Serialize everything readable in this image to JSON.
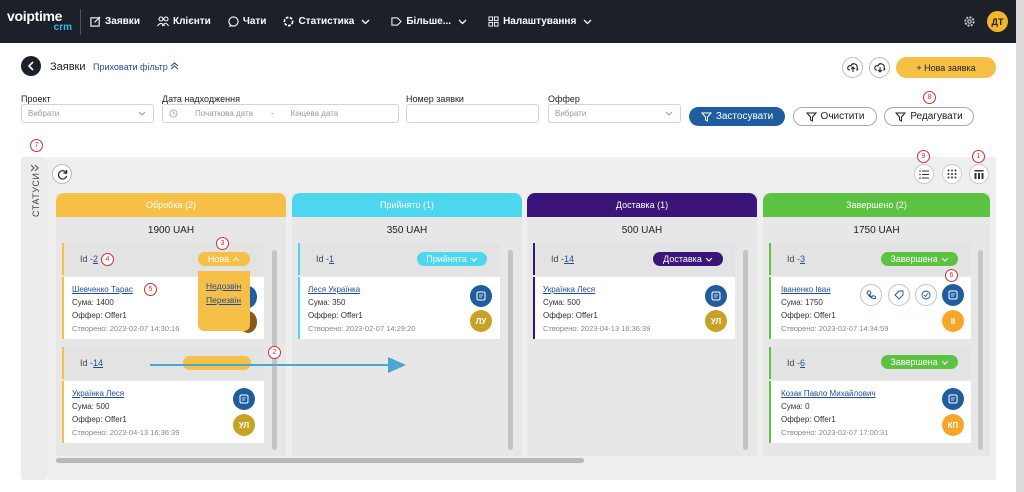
{
  "app": {
    "logo_top": "voiptime",
    "logo_bottom": "crm",
    "user_initials": "ДТ"
  },
  "nav": [
    {
      "label": "Заявки",
      "icon": "edit-icon",
      "has_chevron": false
    },
    {
      "label": "Клієнти",
      "icon": "people-icon",
      "has_chevron": false
    },
    {
      "label": "Чати",
      "icon": "chat-icon",
      "has_chevron": false
    },
    {
      "label": "Статистика",
      "icon": "stats-icon",
      "has_chevron": true
    },
    {
      "label": "Більше...",
      "icon": "tag-icon",
      "has_chevron": true
    },
    {
      "label": "Налаштування",
      "icon": "grid-icon",
      "has_chevron": true
    }
  ],
  "page": {
    "title": "Заявки",
    "hide_filter": "Приховати фільтр",
    "new_request": "+ Нова заявка"
  },
  "filters": {
    "project_label": "Проект",
    "project_placeholder": "Вибрати",
    "date_label": "Дата надходження",
    "date_start": "Початкова дата",
    "date_end": "Кінцева дата",
    "number_label": "Номер заявки",
    "offer_label": "Оффер",
    "offer_placeholder": "Вибрати",
    "apply": "Застосувати",
    "clear": "Очистити",
    "edit": "Редагувати"
  },
  "sidebar_label": "СТАТУСИ",
  "annotations": [
    "1",
    "2",
    "3",
    "4",
    "5",
    "6",
    "7",
    "8",
    "9"
  ],
  "columns": [
    {
      "title": "Обробка (2)",
      "sum": "1900 UAH",
      "color": "#f6c047"
    },
    {
      "title": "Прийнято (1)",
      "sum": "350 UAH",
      "color": "#4dd7ee"
    },
    {
      "title": "Доставка (1)",
      "sum": "500 UAH",
      "color": "#3a1478"
    },
    {
      "title": "Завершено (2)",
      "sum": "1750 UAH",
      "color": "#5cc241"
    }
  ],
  "cards": [
    {
      "id_prefix": "Id -",
      "id": "2",
      "status": "Нова",
      "name": "Шевченко Тарас",
      "sum": "Сума: 1400",
      "offer": "Оффер: Offer1",
      "created": "Створено: 2023-02-07 14:30:16",
      "initials": ""
    },
    {
      "id_prefix": "Id -",
      "id": "14",
      "status": "Нова",
      "name": "Українка Леся",
      "sum": "Сума: 500",
      "offer": "Оффер: Offer1",
      "created": "Створено: 2023-04-13 16:36:39",
      "initials": "УЛ"
    },
    {
      "id_prefix": "Id -",
      "id": "1",
      "status": "Прийнята",
      "name": "Леся Українка",
      "sum": "Сума: 350",
      "offer": "Оффер: Offer1",
      "created": "Створено: 2023-02-07 14:29:20",
      "initials": "ЛУ"
    },
    {
      "id_prefix": "Id -",
      "id": "14",
      "status": "Доставка",
      "name": "Українка Леся",
      "sum": "Сума: 500",
      "offer": "Оффер: Offer1",
      "created": "Створено: 2023-04-13 16:36:39",
      "initials": "УЛ"
    },
    {
      "id_prefix": "Id -",
      "id": "3",
      "status": "Завершена",
      "name": "Іваненко Іван",
      "sum": "Сума: 1750",
      "offer": "Оффер: Offer1",
      "created": "Створено: 2023-02-07 14:34:59",
      "initials": "ІІ"
    },
    {
      "id_prefix": "Id -",
      "id": "6",
      "status": "Завершена",
      "name": "Козак Павло Михайлович",
      "sum": "Сума: 0",
      "offer": "Оффер: Offer1",
      "created": "Створено: 2023-02-07 17:00:31",
      "initials": "КП"
    }
  ],
  "dropdown": {
    "items": [
      "Недозвін",
      "Перезвін"
    ]
  }
}
